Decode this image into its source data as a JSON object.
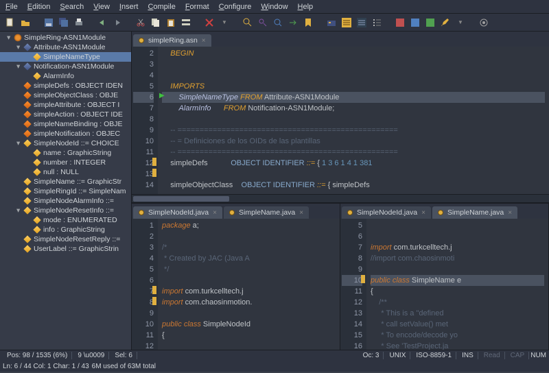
{
  "menu": [
    "File",
    "Edition",
    "Search",
    "View",
    "Insert",
    "Compile",
    "Format",
    "Configure",
    "Window",
    "Help"
  ],
  "tree": {
    "root": "SimpleRing-ASN1Module",
    "items": [
      {
        "l": 2,
        "t": "mod",
        "tw": "▾",
        "x": "Attribute-ASN1Module"
      },
      {
        "l": 3,
        "t": "typ",
        "x": "SimpleNameType",
        "sel": true
      },
      {
        "l": 2,
        "t": "mod",
        "tw": "▾",
        "x": "Notification-ASN1Module"
      },
      {
        "l": 3,
        "t": "typ",
        "x": "AlarmInfo"
      },
      {
        "l": 2,
        "t": "fld",
        "x": "simpleDefs : OBJECT IDEN"
      },
      {
        "l": 2,
        "t": "fld",
        "x": "simpleObjectClass : OBJE"
      },
      {
        "l": 2,
        "t": "fld",
        "x": "simpleAttribute : OBJECT I"
      },
      {
        "l": 2,
        "t": "fld",
        "x": "simpleAction : OBJECT IDE"
      },
      {
        "l": 2,
        "t": "fld",
        "x": "simpleNameBinding : OBJE"
      },
      {
        "l": 2,
        "t": "fld",
        "x": "simpleNotification : OBJEC"
      },
      {
        "l": 2,
        "t": "typ",
        "tw": "▾",
        "x": "SimpleNodeId ::= CHOICE"
      },
      {
        "l": 3,
        "t": "typ",
        "x": "name : GraphicString"
      },
      {
        "l": 3,
        "t": "typ",
        "x": "number : INTEGER"
      },
      {
        "l": 3,
        "t": "typ",
        "x": "null : NULL"
      },
      {
        "l": 2,
        "t": "typ",
        "x": "SimpleName ::= GraphicStr"
      },
      {
        "l": 2,
        "t": "typ",
        "x": "SimpleRingId ::= SimpleNam"
      },
      {
        "l": 2,
        "t": "typ",
        "x": "SimpleNodeAlarmInfo ::= "
      },
      {
        "l": 2,
        "t": "typ",
        "tw": "▾",
        "x": "SimpleNodeResetInfo ::="
      },
      {
        "l": 3,
        "t": "typ",
        "x": "mode : ENUMERATED"
      },
      {
        "l": 3,
        "t": "typ",
        "x": "info : GraphicString"
      },
      {
        "l": 2,
        "t": "typ",
        "x": "SimpleNodeResetReply ::="
      },
      {
        "l": 2,
        "t": "typ",
        "x": "UserLabel ::= GraphicStrin"
      }
    ]
  },
  "top_tab": "simpleRing.asn",
  "top_editor": {
    "lines": [
      2,
      3,
      4,
      5,
      6,
      7,
      8,
      9,
      10,
      11,
      12,
      13,
      14
    ],
    "code": [
      "    <span class='kw'>BEGIN</span>",
      "",
      "",
      "    <span class='kw'>IMPORTS</span>",
      "        <span class='id'>SimpleNameType</span> <span class='kw'>FROM</span> Attribute-ASN1Module",
      "        <span class='id'>AlarmInfo</span>      <span class='kw'>FROM</span> Notification-ASN1Module;",
      "",
      "    <span class='cmt'>-- ==================================================</span>",
      "    <span class='cmt'>-- = Definiciones de los OIDs de las plantillas     </span>",
      "    <span class='cmt'>-- ==================================================</span>",
      "    simpleDefs           <span class='str'>OBJECT IDENTIFIER</span> <span class='kw'>::=</span> { <span class='num'>1 3 6 1 4 1 381</span>",
      "",
      "    simpleObjectClass    <span class='str'>OBJECT IDENTIFIER</span> <span class='kw'>::=</span> { simpleDefs "
    ],
    "hl": 4,
    "mark": [
      10,
      11
    ],
    "arrow": 4
  },
  "bl_tabs": [
    "SimpleNodeId.java",
    "SimpleName.java"
  ],
  "bl_editor": {
    "lines": [
      1,
      2,
      3,
      4,
      5,
      6,
      7,
      8,
      9,
      10,
      11,
      12
    ],
    "code": [
      "<span class='kw2'>package</span> a;",
      "",
      "<span class='cmt'>/*</span>",
      "<span class='cmt'> * Created by JAC (Java A</span>",
      "<span class='cmt'> */</span>",
      "",
      "<span class='kw2'>import</span> com.turkcelltech.j",
      "<span class='kw2'>import</span> com.chaosinmotion.",
      "",
      "<span class='kw2'>public</span> <span class='kw2'>class</span> SimpleNodeId",
      "{",
      ""
    ],
    "mark": [
      6,
      7
    ]
  },
  "br_tabs": [
    "SimpleNodeId.java",
    "SimpleName.java"
  ],
  "br_editor": {
    "lines": [
      5,
      6,
      7,
      8,
      9,
      10,
      11,
      12,
      13,
      14,
      15,
      16
    ],
    "code": [
      "",
      "",
      "<span class='kw2'>import</span> com.turkcelltech.j",
      "<span class='cmt'>//import com.chaosinmoti</span>",
      "",
      "<span class='kw2'>public</span> <span class='kw2'>class</span> SimpleName e",
      "{",
      "    <span class='cmt'>/**</span>",
      "    <span class='cmt'> * This is a \"defined</span>",
      "    <span class='cmt'> * call setValue() met</span>",
      "    <span class='cmt'> * To encode/decode yo</span>",
      "    <span class='cmt'> * See 'TestProject.ja</span>"
    ],
    "hl": 5,
    "mark": [
      5
    ]
  },
  "status_l": {
    "ln": "Ln: 6 / 44  Col: 1  Char: 1 / 43"
  },
  "status_m": {
    "pos": "Pos: 98 / 1535 (6%)",
    "ch": "9  \\u0009",
    "sel": "Sel: 6"
  },
  "status_r": {
    "oc": "Oc: 3",
    "os": "UNIX",
    "enc": "ISO-8859-1",
    "ins": "INS",
    "read": "Read",
    "cap": "CAP",
    "num": "NUM"
  },
  "mem": "6M used of 63M total"
}
